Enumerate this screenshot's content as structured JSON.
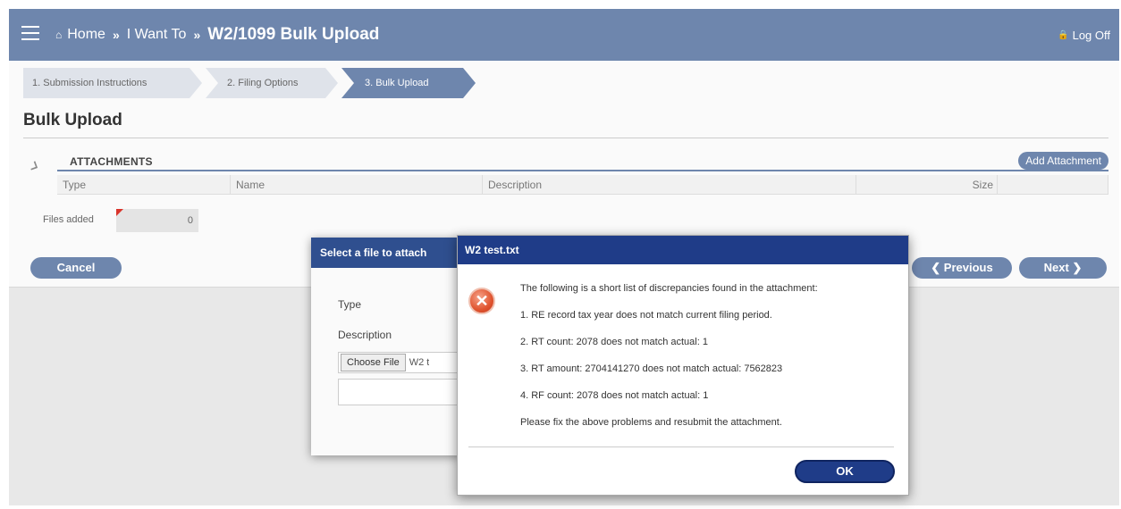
{
  "header": {
    "home_label": "Home",
    "home_icon": "home-icon",
    "separator": "»",
    "crumb_2": "I Want To",
    "current": "W2/1099 Bulk Upload",
    "logoff_label": "Log Off",
    "logoff_icon": "lock-icon",
    "color": "#6e86ad"
  },
  "steps": [
    {
      "label": "1. Submission Instructions"
    },
    {
      "label": "2. Filing Options"
    },
    {
      "label": "3. Bulk Upload"
    }
  ],
  "page_title": "Bulk Upload",
  "attachments": {
    "label": "ATTACHMENTS",
    "add_button": "Add Attachment",
    "columns": [
      "Type",
      "Name",
      "Description",
      "Size"
    ]
  },
  "files_added": {
    "label": "Files added",
    "count": "0"
  },
  "buttons": {
    "cancel": "Cancel",
    "previous": "Previous",
    "next": "Next"
  },
  "file_modal": {
    "title": "Select a file to attach",
    "type_label": "Type",
    "description_label": "Description",
    "choose_file": "Choose File",
    "filename": "W2 t"
  },
  "error_modal": {
    "title": "W2 test.txt",
    "lines": [
      "The following is a short list of discrepancies found in the attachment:",
      "1. RE record tax year does not match current filing period.",
      "2. RT count: 2078 does not match actual: 1",
      "3. RT amount: 2704141270 does not match actual: 7562823",
      "4. RF count: 2078 does not match actual: 1",
      "Please fix the above problems and resubmit the attachment."
    ],
    "ok": "OK",
    "title_color": "#1f3c88"
  }
}
